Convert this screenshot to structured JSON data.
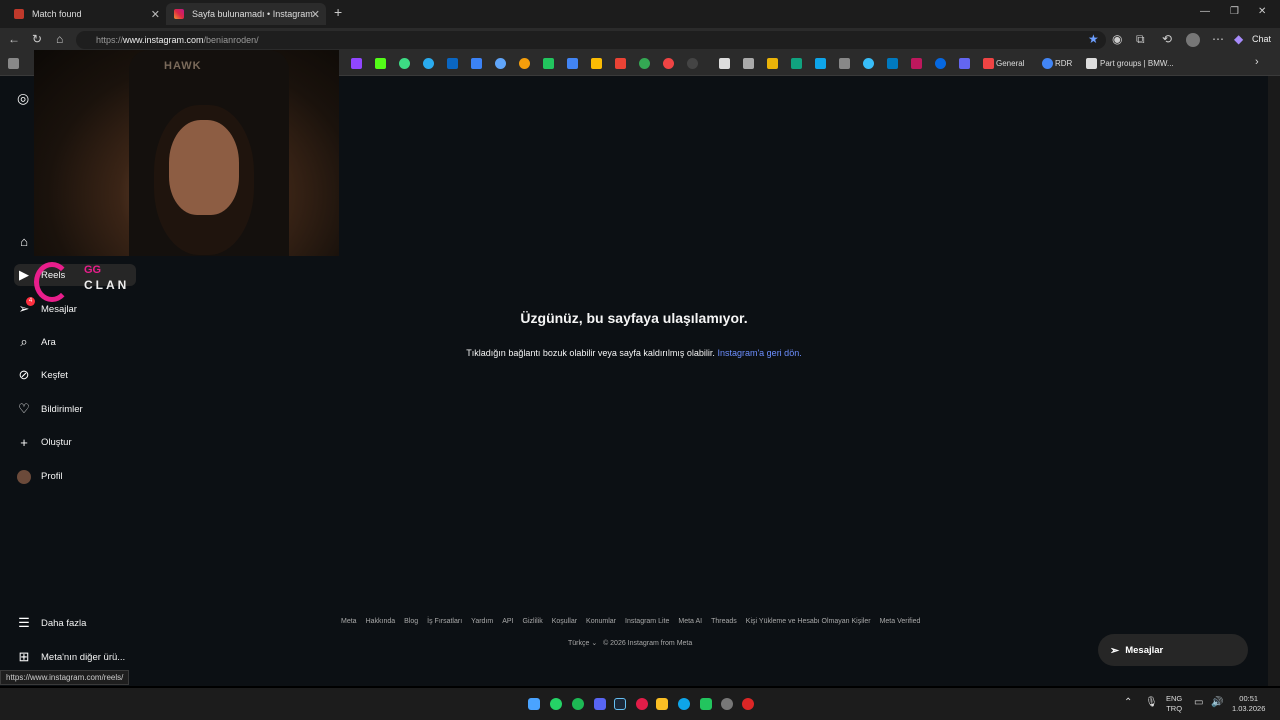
{
  "browser": {
    "tabs": [
      {
        "label": "Match found",
        "active": false
      },
      {
        "label": "Sayfa bulunamadı • Instagram",
        "active": true
      }
    ],
    "url_scheme": "https://",
    "url_host": "www.instagram.com",
    "url_path": "/benianroden/",
    "chat_label": "Chat",
    "bookmarks_text": [
      "General",
      "RDR",
      "Part groups | BMW..."
    ],
    "status_url": "https://www.instagram.com/reels/"
  },
  "webcam": {
    "brand": "HAWK"
  },
  "overlay": {
    "gg": "GG",
    "clan": "CLAN"
  },
  "sidebar": {
    "items": [
      {
        "icon": "home-icon",
        "label": ""
      },
      {
        "icon": "reels-icon",
        "label": "Reels"
      },
      {
        "icon": "messages-icon",
        "label": "Mesajlar",
        "badge": "4"
      },
      {
        "icon": "search-icon",
        "label": "Ara"
      },
      {
        "icon": "explore-icon",
        "label": "Keşfet"
      },
      {
        "icon": "heart-icon",
        "label": "Bildirimler"
      },
      {
        "icon": "plus-icon",
        "label": "Oluştur"
      },
      {
        "icon": "avatar",
        "label": "Profil"
      }
    ],
    "more": "Daha fazla",
    "meta_products": "Meta'nın diğer ürü..."
  },
  "main": {
    "title": "Üzgünüz, bu sayfaya ulaşılamıyor.",
    "message": "Tıkladığın bağlantı bozuk olabilir veya sayfa kaldırılmış olabilir.",
    "link": "Instagram'a geri dön."
  },
  "footer": {
    "links": [
      "Meta",
      "Hakkında",
      "Blog",
      "İş Fırsatları",
      "Yardım",
      "API",
      "Gizlilik",
      "Koşullar",
      "Konumlar",
      "Instagram Lite",
      "Meta AI",
      "Threads",
      "Kişi Yükleme ve Hesabı Olmayan Kişiler",
      "Meta Verified"
    ],
    "language": "Türkçe",
    "copyright": "© 2026 Instagram from Meta"
  },
  "messages_pill": "Mesajlar",
  "taskbar": {
    "lang": "ENG",
    "region": "TRQ",
    "time": "00:51",
    "date": "1.03.2026"
  }
}
